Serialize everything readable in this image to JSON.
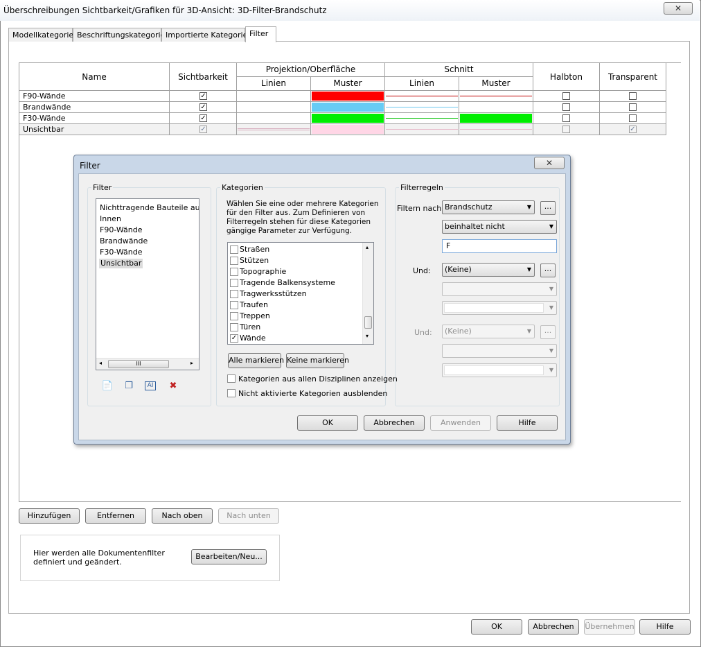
{
  "window": {
    "title": "Überschreibungen Sichtbarkeit/Grafiken für 3D-Ansicht: 3D-Filter-Brandschutz",
    "close_glyph": "✕"
  },
  "tabs": [
    {
      "label": "Modellkategorien",
      "active": false
    },
    {
      "label": "Beschriftungskategorien",
      "active": false
    },
    {
      "label": "Importierte Kategorien",
      "active": false
    },
    {
      "label": "Filter",
      "active": true
    }
  ],
  "grid": {
    "headers": {
      "name": "Name",
      "visibility": "Sichtbarkeit",
      "projection": "Projektion/Oberfläche",
      "cut": "Schnitt",
      "lines": "Linien",
      "pattern": "Muster",
      "halftone": "Halbton",
      "transparent": "Transparent"
    },
    "rows": [
      {
        "name": "F90-Wände",
        "visible": true,
        "proj_pattern_color": "#ff0000",
        "cut_line_color": "#c00000",
        "cut_pattern_color": "",
        "cut_pattern_line_color": "#c00000",
        "halftone": false,
        "transparent": false
      },
      {
        "name": "Brandwände",
        "visible": true,
        "proj_pattern_color": "#66ccf5",
        "cut_line_color": "#6cc6ef",
        "cut_pattern_color": "",
        "cut_pattern_line_color": "",
        "halftone": false,
        "transparent": false
      },
      {
        "name": "F30-Wände",
        "visible": true,
        "proj_pattern_color": "#00ee00",
        "cut_line_color": "#00c000",
        "cut_pattern_color": "#00ee00",
        "cut_pattern_line_color": "",
        "halftone": false,
        "transparent": false
      },
      {
        "name": "Unsichtbar",
        "visible": true,
        "proj_pattern_color": "#ffd6e6",
        "cut_line_color": "#e6b8c8",
        "cut_pattern_color": "",
        "cut_pattern_line_color": "#e6b8c8",
        "halftone": false,
        "transparent": true,
        "selected": true
      }
    ]
  },
  "buttons": {
    "add": "Hinzufügen",
    "remove": "Entfernen",
    "up": "Nach oben",
    "down": "Nach unten",
    "edit_new": "Bearbeiten/Neu...",
    "ok": "OK",
    "cancel": "Abbrechen",
    "apply": "Übernehmen",
    "help": "Hilfe"
  },
  "info": {
    "line1": "Hier werden alle Dokumentenfilter",
    "line2": "definiert und geändert."
  },
  "filter_dialog": {
    "title": "Filter",
    "close_glyph": "✕",
    "filter_group_label": "Filter",
    "filters": [
      {
        "label": "Nichttragende Bauteile ausblenden",
        "selected": false
      },
      {
        "label": "Innen",
        "selected": false
      },
      {
        "label": "F90-Wände",
        "selected": false
      },
      {
        "label": "Brandwände",
        "selected": false
      },
      {
        "label": "F30-Wände",
        "selected": false
      },
      {
        "label": "Unsichtbar",
        "selected": true
      }
    ],
    "hscroll_thumb_glyph": "III",
    "categories_group_label": "Kategorien",
    "categories_desc_1": "Wählen Sie eine oder mehrere Kategorien",
    "categories_desc_2": "für den Filter aus. Zum Definieren von",
    "categories_desc_3": "Filterregeln stehen für diese Kategorien",
    "categories_desc_4": "gängige Parameter zur Verfügung.",
    "categories": [
      {
        "label": "Straßen",
        "checked": false
      },
      {
        "label": "Stützen",
        "checked": false
      },
      {
        "label": "Topographie",
        "checked": false
      },
      {
        "label": "Tragende Balkensysteme",
        "checked": false
      },
      {
        "label": "Tragwerksstützen",
        "checked": false
      },
      {
        "label": "Traufen",
        "checked": false
      },
      {
        "label": "Treppen",
        "checked": false
      },
      {
        "label": "Türen",
        "checked": false
      },
      {
        "label": "Wände",
        "checked": true
      }
    ],
    "check_all": "Alle markieren",
    "check_none": "Keine markieren",
    "show_all_disciplines": "Kategorien aus allen Disziplinen anzeigen",
    "hide_unchecked": "Nicht aktivierte Kategorien ausblenden",
    "rules_group_label": "Filterregeln",
    "filter_by_label": "Filtern nach:",
    "filter_by_value": "Brandschutz",
    "operator_value": "beinhaltet nicht",
    "rule_value": "F",
    "and1_label": "Und:",
    "and1_value": "(Keine)",
    "and2_label": "Und:",
    "and2_value": "(Keine)",
    "ellipsis": "...",
    "ok": "OK",
    "cancel": "Abbrechen",
    "apply": "Anwenden",
    "help": "Hilfe"
  }
}
